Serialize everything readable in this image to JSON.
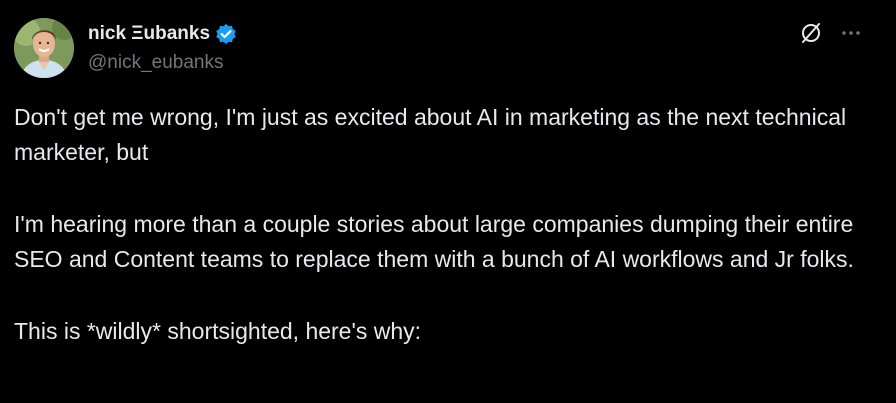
{
  "author": {
    "display_name": "nick Ξubanks",
    "handle": "@nick_eubanks",
    "verified": true,
    "avatar_icon": "avatar-photo"
  },
  "actions": {
    "grok_icon": "slashed-circle-icon",
    "more_icon": "more-horizontal-icon",
    "more_label": "···"
  },
  "tweet": {
    "paragraphs": [
      "Don't get me wrong, I'm just as excited about AI in marketing as the next technical marketer, but",
      "I'm hearing more than a couple stories about large companies dumping their entire SEO and Content teams to replace them with a bunch of AI workflows and Jr folks.",
      "This is *wildly* shortsighted, here's why:"
    ]
  },
  "colors": {
    "background": "#000000",
    "text": "#e7e9ea",
    "muted": "#71767b",
    "verified": "#1d9bf0"
  }
}
